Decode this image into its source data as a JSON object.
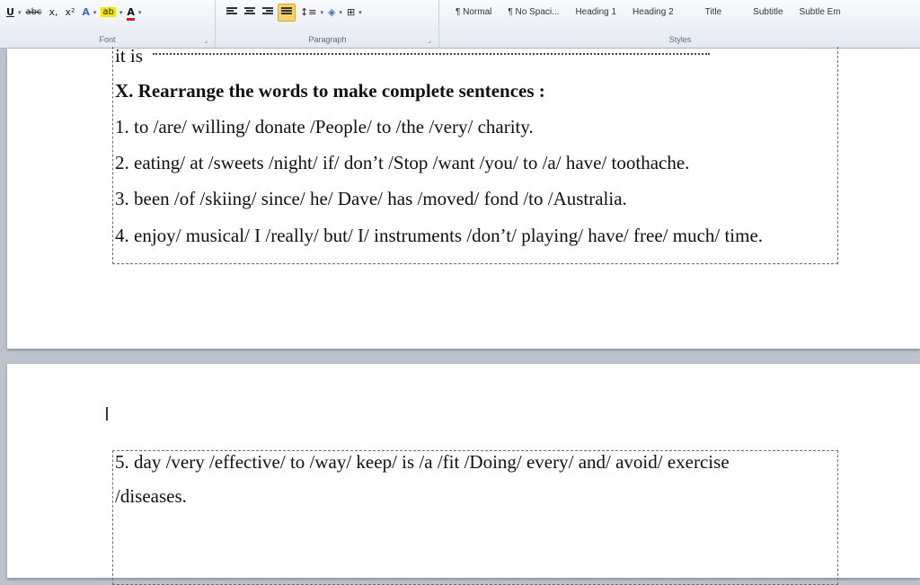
{
  "ribbon": {
    "font_group": {
      "label": "Font",
      "underline": "U",
      "strike": "abc",
      "subscript": "x,",
      "superscript": "x²",
      "text_effects": "A",
      "highlight": "ab",
      "font_color": "A"
    },
    "paragraph_group": {
      "label": "Paragraph"
    },
    "styles_group": {
      "label": "Styles",
      "items": [
        "¶ Normal",
        "¶ No Spaci...",
        "Heading 1",
        "Heading 2",
        "Title",
        "Subtitle",
        "Subtle Em"
      ]
    }
  },
  "document": {
    "page1": {
      "partial_line": "it is",
      "heading": "X. Rearrange the words to make complete sentences :",
      "items": [
        "1. to /are/ willing/ donate /People/ to /the /very/ charity.",
        "2. eating/ at /sweets /night/ if/ don’t /Stop /want /you/ to /a/ have/ toothache.",
        "3. been /of /skiing/ since/ he/ Dave/ has /moved/ fond /to /Australia.",
        "4. enjoy/ musical/ I /really/ but/ I/ instruments /don’t/ playing/ have/ free/ much/ time."
      ]
    },
    "page2": {
      "cursor": "I",
      "items": [
        "5. day /very /effective/ to /way/ keep/ is /a /fit /Doing/ every/ and/ avoid/ exercise",
        "/diseases."
      ]
    }
  }
}
